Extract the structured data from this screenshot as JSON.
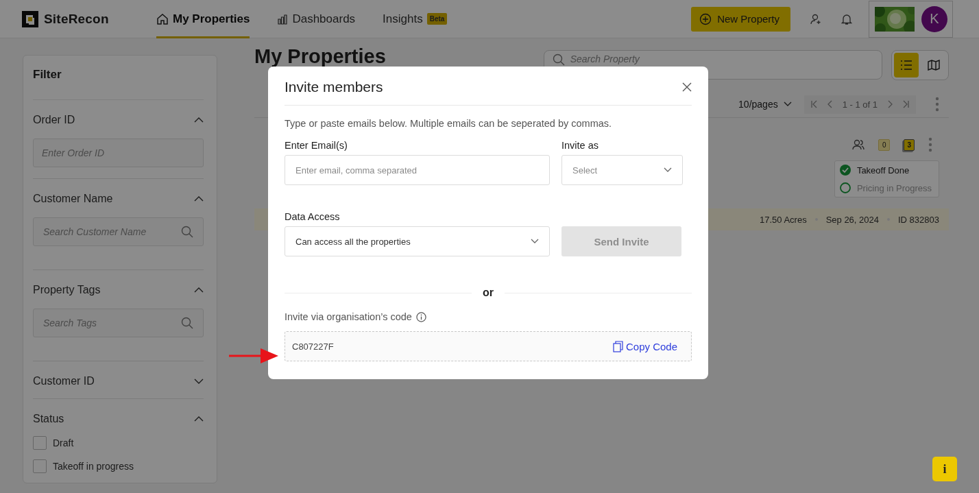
{
  "header": {
    "logo": "SiteRecon",
    "nav": [
      {
        "label": "My Properties",
        "selected": true,
        "kind": "home"
      },
      {
        "label": "Dashboards",
        "selected": false,
        "kind": "chart"
      },
      {
        "label": "Insights",
        "selected": false,
        "kind": "plain",
        "badge": "Beta"
      }
    ],
    "new_property": "New Property",
    "avatar": "K"
  },
  "filter": {
    "title": "Filter",
    "sections": [
      {
        "title": "Order ID",
        "expanded": true,
        "kind": "input",
        "placeholder": "Enter Order ID"
      },
      {
        "title": "Customer Name",
        "expanded": true,
        "kind": "search",
        "placeholder": "Search Customer Name"
      },
      {
        "title": "Property Tags",
        "expanded": true,
        "kind": "search",
        "placeholder": "Search Tags"
      },
      {
        "title": "Customer ID",
        "expanded": false
      },
      {
        "title": "Status",
        "expanded": true,
        "kind": "checks",
        "options": [
          {
            "label": "Draft",
            "checked": false
          },
          {
            "label": "Takeoff in progress",
            "checked": false
          }
        ]
      }
    ]
  },
  "main": {
    "title": "My Properties",
    "search": {
      "placeholder": "Search Property"
    },
    "view_toggle": [
      {
        "kind": "list",
        "selected": true
      },
      {
        "kind": "map",
        "selected": false
      }
    ],
    "page_size": "10/pages",
    "range": "1 - 1 of 1",
    "property": {
      "comments": "0",
      "files": "3",
      "steps": [
        {
          "label": "Takeoff Done",
          "done": true
        },
        {
          "label": "Pricing in Progress",
          "done": false
        }
      ],
      "area": "17.50 Acres",
      "date": "Sep 26, 2024",
      "id": "ID 832803"
    }
  },
  "modal": {
    "title": "Invite members",
    "intro": "Type or paste emails below. Multiple emails can be seperated by commas.",
    "email_label": "Enter Email(s)",
    "email_placeholder": "Enter email, comma separated",
    "invite_as_label": "Invite as",
    "invite_as_placeholder": "Select",
    "data_access_label": "Data Access",
    "data_access_value": "Can access all the properties",
    "send_button": {
      "label": "Send Invite",
      "disabled": true
    },
    "divider": "or",
    "code_label": "Invite via organisation’s code",
    "code": "C807227F",
    "copy": "Copy Code"
  },
  "help_button": "i"
}
